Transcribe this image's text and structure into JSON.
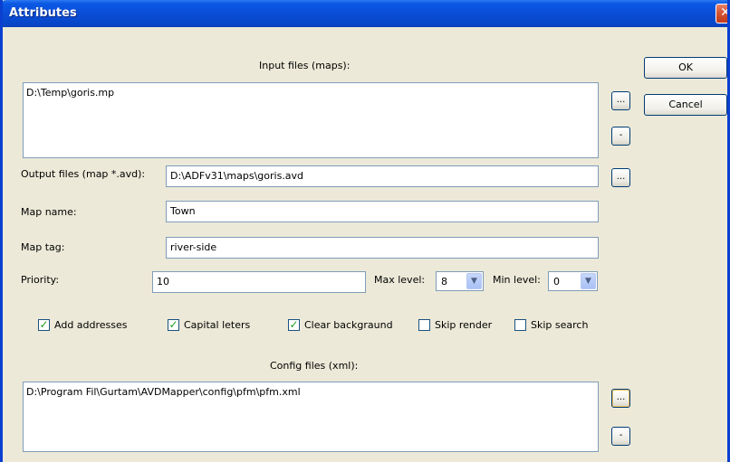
{
  "window": {
    "title": "Attributes"
  },
  "buttons": {
    "ok": "OK",
    "cancel": "Cancel",
    "browse": "...",
    "remove": "-"
  },
  "input_files": {
    "label": "Input files (maps):",
    "items": [
      "D:\\Temp\\goris.mp"
    ]
  },
  "output": {
    "label": "Output files (map *.avd):",
    "value": "D:\\ADFv31\\maps\\goris.avd"
  },
  "map_name": {
    "label": "Map name:",
    "value": "Town"
  },
  "map_tag": {
    "label": "Map tag:",
    "value": "river-side"
  },
  "priority": {
    "label": "Priority:",
    "value": "10"
  },
  "max_level": {
    "label": "Max level:",
    "value": "8"
  },
  "min_level": {
    "label": "Min level:",
    "value": "0"
  },
  "options": [
    {
      "label": "Add addresses",
      "checked": true
    },
    {
      "label": "Capital leters",
      "checked": true
    },
    {
      "label": "Clear backgraund",
      "checked": true
    },
    {
      "label": "Skip render",
      "checked": false
    },
    {
      "label": "Skip search",
      "checked": false
    }
  ],
  "config_files": {
    "label": "Config files (xml):",
    "items": [
      "D:\\Program Fil\\Gurtam\\AVDMapper\\config\\pfm\\pfm.xml"
    ]
  },
  "colors": {
    "title_bar": "#0a4dd6",
    "dialog_bg": "#ece9d8",
    "check_mark": "#21a121",
    "close_button": "#d4512f"
  }
}
